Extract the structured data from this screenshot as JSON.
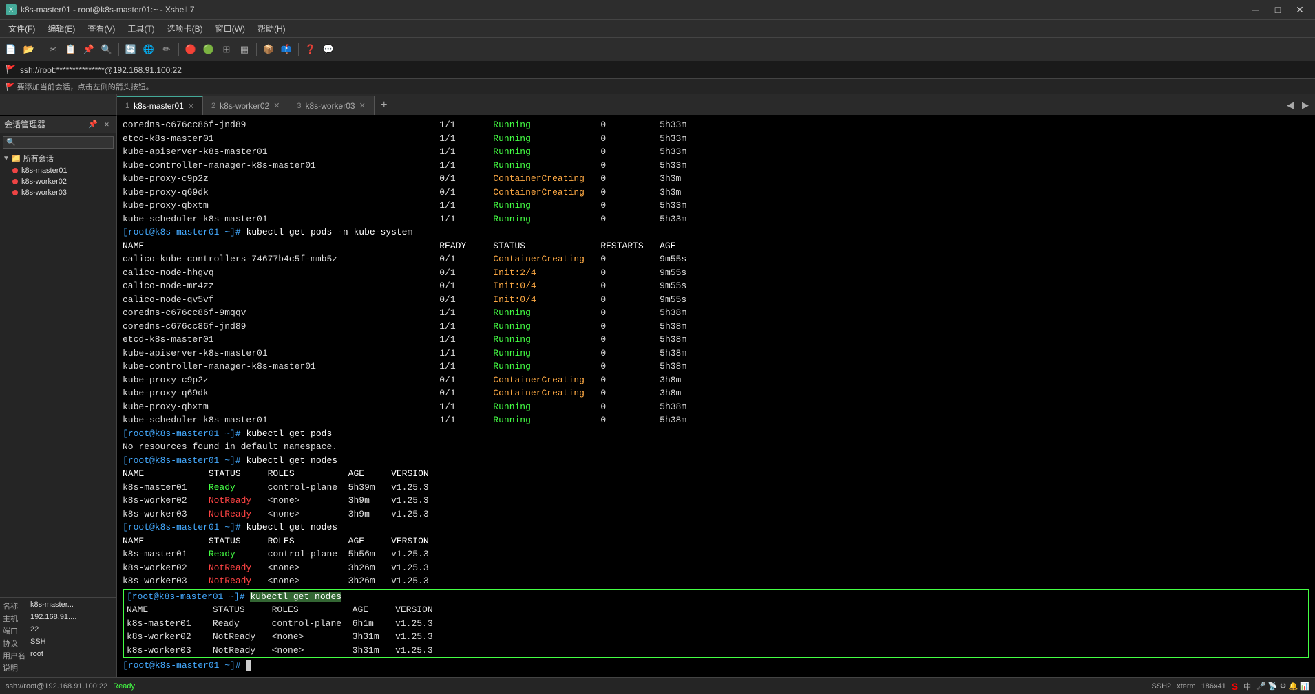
{
  "title_bar": {
    "title": "k8s-master01 - root@k8s-master01:~ - Xshell 7",
    "min_label": "─",
    "max_label": "□",
    "close_label": "✕"
  },
  "menu_bar": {
    "items": [
      "文件(F)",
      "编辑(E)",
      "查看(V)",
      "工具(T)",
      "选项卡(B)",
      "窗口(W)",
      "帮助(H)"
    ]
  },
  "address_bar": {
    "text": "ssh://root:***************@192.168.91.100:22"
  },
  "info_bar": {
    "text": "🚩 要添加当前会话，点击左侧的箭头按钮。"
  },
  "sidebar": {
    "title": "会话管理器",
    "search_placeholder": "",
    "all_sessions_label": "所有会话",
    "sessions": [
      {
        "name": "k8s-master01",
        "active": true
      },
      {
        "name": "k8s-worker02",
        "active": false
      },
      {
        "name": "k8s-worker03",
        "active": false
      }
    ],
    "props": {
      "name_label": "名称",
      "name_value": "k8s-master...",
      "host_label": "主机",
      "host_value": "192.168.91....",
      "port_label": "端口",
      "port_value": "22",
      "proto_label": "协议",
      "proto_value": "SSH",
      "user_label": "用户名",
      "user_value": "root",
      "desc_label": "说明",
      "desc_value": ""
    }
  },
  "tabs": [
    {
      "num": "1",
      "name": "k8s-master01",
      "active": true
    },
    {
      "num": "2",
      "name": "k8s-worker02",
      "active": false
    },
    {
      "num": "3",
      "name": "k8s-worker03",
      "active": false
    }
  ],
  "terminal": {
    "lines": [
      {
        "type": "normal",
        "text": "coredns-c676cc86f-jnd89                                    1/1       Running             0          5h33m"
      },
      {
        "type": "normal",
        "text": "etcd-k8s-master01                                          1/1       Running             0          5h33m"
      },
      {
        "type": "normal",
        "text": "kube-apiserver-k8s-master01                                1/1       Running             0          5h33m"
      },
      {
        "type": "normal",
        "text": "kube-controller-manager-k8s-master01                       1/1       Running             0          5h33m"
      },
      {
        "type": "normal",
        "text": "kube-proxy-c9p2z                                           0/1       ContainerCreating   0          3h3m"
      },
      {
        "type": "normal",
        "text": "kube-proxy-q69dk                                           0/1       ContainerCreating   0          3h3m"
      },
      {
        "type": "normal",
        "text": "kube-proxy-qbxtm                                           1/1       Running             0          5h33m"
      },
      {
        "type": "normal",
        "text": "kube-scheduler-k8s-master01                                1/1       Running             0          5h33m"
      },
      {
        "type": "prompt",
        "text": "[root@k8s-master01 ~]# kubectl get pods -n kube-system"
      },
      {
        "type": "header",
        "text": "NAME                                                       READY     STATUS              RESTARTS   AGE"
      },
      {
        "type": "normal",
        "text": "calico-kube-controllers-74677b4c5f-mmb5z                   0/1       ContainerCreating   0          9m55s"
      },
      {
        "type": "normal",
        "text": "calico-node-hhgvq                                          0/1       Init:2/4            0          9m55s"
      },
      {
        "type": "normal",
        "text": "calico-node-mr4zz                                          0/1       Init:0/4            0          9m55s"
      },
      {
        "type": "normal",
        "text": "calico-node-qv5vf                                          0/1       Init:0/4            0          9m55s"
      },
      {
        "type": "normal",
        "text": "coredns-c676cc86f-9mqqv                                    1/1       Running             0          5h38m"
      },
      {
        "type": "normal",
        "text": "coredns-c676cc86f-jnd89                                    1/1       Running             0          5h38m"
      },
      {
        "type": "normal",
        "text": "etcd-k8s-master01                                          1/1       Running             0          5h38m"
      },
      {
        "type": "normal",
        "text": "kube-apiserver-k8s-master01                                1/1       Running             0          5h38m"
      },
      {
        "type": "normal",
        "text": "kube-controller-manager-k8s-master01                       1/1       Running             0          5h38m"
      },
      {
        "type": "normal",
        "text": "kube-proxy-c9p2z                                           0/1       ContainerCreating   0          3h8m"
      },
      {
        "type": "normal",
        "text": "kube-proxy-q69dk                                           0/1       ContainerCreating   0          3h8m"
      },
      {
        "type": "normal",
        "text": "kube-proxy-qbxtm                                           1/1       Running             0          5h38m"
      },
      {
        "type": "normal",
        "text": "kube-scheduler-k8s-master01                                1/1       Running             0          5h38m"
      },
      {
        "type": "prompt",
        "text": "[root@k8s-master01 ~]# kubectl get pods"
      },
      {
        "type": "normal",
        "text": "No resources found in default namespace."
      },
      {
        "type": "prompt",
        "text": "[root@k8s-master01 ~]# kubectl get nodes"
      },
      {
        "type": "header",
        "text": "NAME            STATUS     ROLES          AGE     VERSION"
      },
      {
        "type": "normal",
        "text": "k8s-master01    Ready      control-plane  5h39m   v1.25.3"
      },
      {
        "type": "normal",
        "text": "k8s-worker02    NotReady   <none>         3h9m    v1.25.3"
      },
      {
        "type": "normal",
        "text": "k8s-worker03    NotReady   <none>         3h9m    v1.25.3"
      },
      {
        "type": "prompt",
        "text": "[root@k8s-master01 ~]# kubectl get nodes"
      },
      {
        "type": "header",
        "text": "NAME            STATUS     ROLES          AGE     VERSION"
      },
      {
        "type": "normal",
        "text": "k8s-master01    Ready      control-plane  5h56m   v1.25.3"
      },
      {
        "type": "normal",
        "text": "k8s-worker02    NotReady   <none>         3h26m   v1.25.3"
      },
      {
        "type": "normal",
        "text": "k8s-worker03    NotReady   <none>         3h26m   v1.25.3"
      },
      {
        "type": "prompt_highlight",
        "text": "[root@k8s-master01 ~]# kubectl get nodes"
      },
      {
        "type": "header_highlight",
        "text": "NAME            STATUS     ROLES          AGE     VERSION"
      },
      {
        "type": "highlight",
        "text": "k8s-master01    Ready      control-plane  6h1m    v1.25.3"
      },
      {
        "type": "highlight",
        "text": "k8s-worker02    NotReady   <none>         3h31m   v1.25.3"
      },
      {
        "type": "highlight",
        "text": "k8s-worker03    NotReady   <none>         3h31m   v1.25.3"
      },
      {
        "type": "prompt_cursor",
        "text": "[root@k8s-master01 ~]# "
      }
    ]
  },
  "status_bar": {
    "left_text": "ssh://root@192.168.91.100:22",
    "ready_label": "Ready",
    "ssh_label": "SSH2",
    "xterm_label": "xterm",
    "size_label": "186x41",
    "s_logo": "S"
  }
}
